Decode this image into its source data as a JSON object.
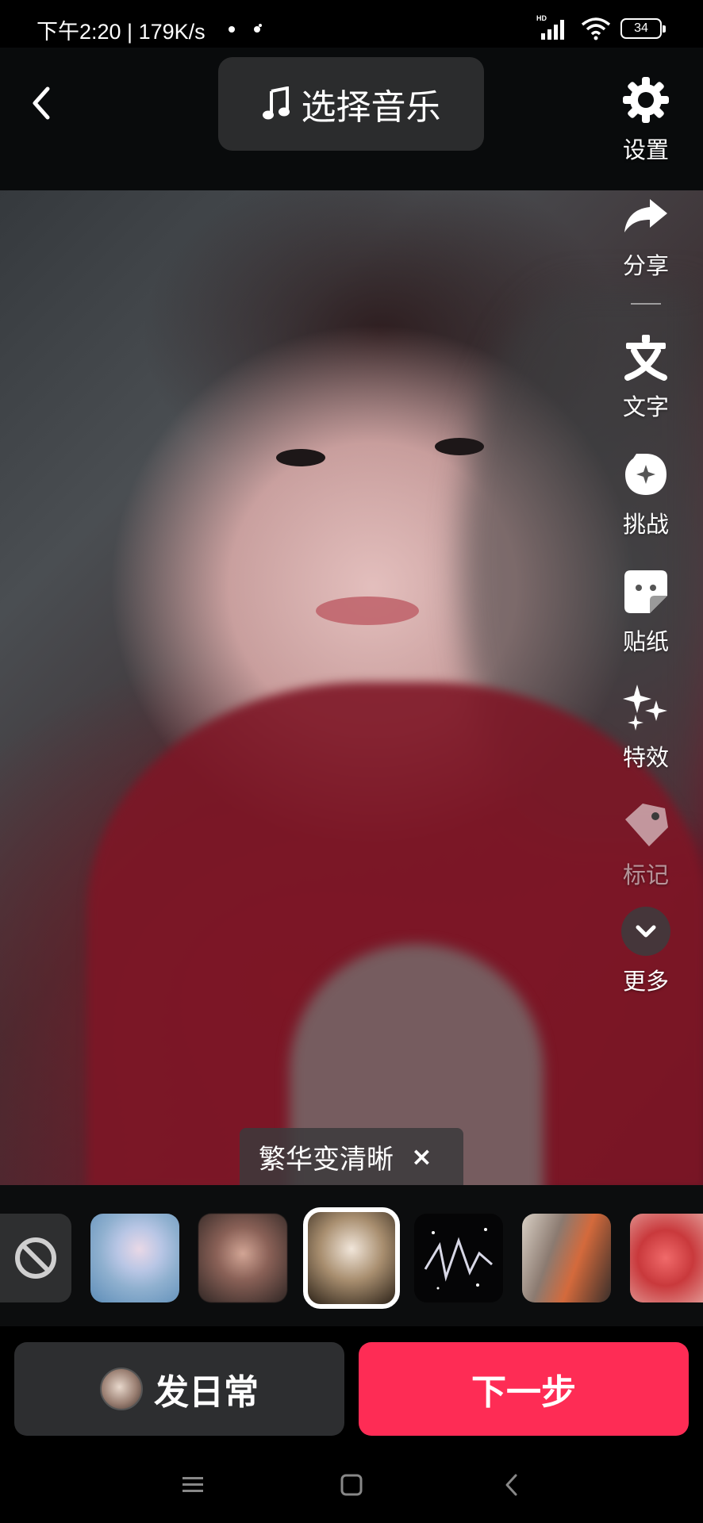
{
  "status_bar": {
    "left_text": "下午2:20 | 179K/s",
    "network_badge": "HD",
    "battery": "34",
    "icons": [
      "signal-icon",
      "wifi-icon",
      "battery-icon"
    ]
  },
  "top_bar": {
    "back_icon": "back-chevron-icon",
    "music_button": {
      "icon": "music-note-icon",
      "label": "选择音乐"
    }
  },
  "tools": [
    {
      "id": "settings",
      "icon": "gear-icon",
      "label": "设置"
    },
    {
      "id": "share",
      "icon": "share-arrow-icon",
      "label": "分享"
    },
    {
      "id": "text",
      "icon": "text-icon",
      "label": "文字"
    },
    {
      "id": "challenge",
      "icon": "challenge-icon",
      "label": "挑战"
    },
    {
      "id": "sticker",
      "icon": "sticker-icon",
      "label": "贴纸"
    },
    {
      "id": "effects",
      "icon": "sparkle-icon",
      "label": "特效"
    },
    {
      "id": "tag",
      "icon": "tag-icon",
      "label": "标记"
    },
    {
      "id": "more",
      "icon": "chevron-down-icon",
      "label": "更多"
    }
  ],
  "filter_chip": {
    "label": "繁华变清晰",
    "close": "×"
  },
  "thumbnails": {
    "selected_index": 3,
    "items": [
      "none",
      "effect-1",
      "effect-2",
      "effect-3",
      "effect-4",
      "effect-5",
      "effect-6"
    ]
  },
  "actions": {
    "daily": {
      "label": "发日常"
    },
    "next": {
      "label": "下一步"
    }
  },
  "nav_bar": {
    "icons": [
      "menu-icon",
      "home-icon",
      "back-icon"
    ]
  },
  "colors": {
    "accent": "#fe2c55",
    "button_dark": "#2d2e30",
    "top_bar_bg": "#090b0c"
  }
}
